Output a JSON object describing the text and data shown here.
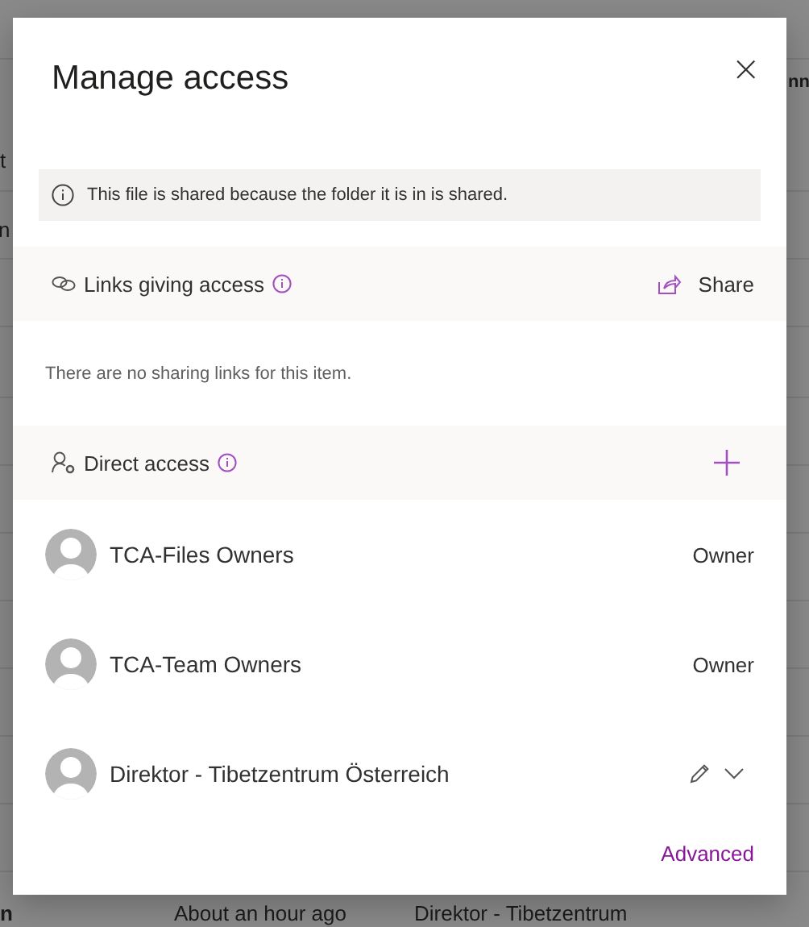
{
  "background": {
    "texts": [
      {
        "text": "nn"
      },
      {
        "text": "t"
      },
      {
        "text": "n"
      },
      {
        "text": "n"
      },
      {
        "text": "About an hour ago"
      },
      {
        "text": "Direktor - Tibetzentrum"
      }
    ]
  },
  "dialog": {
    "title": "Manage access",
    "close": "×",
    "notice": "This file is shared because the folder it is in is shared.",
    "links": {
      "heading": "Links giving access",
      "action": "Share",
      "empty": "There are no sharing links for this item."
    },
    "direct": {
      "heading": "Direct access"
    },
    "members": [
      {
        "name": "TCA-Files Owners",
        "kind": "role",
        "role": "Owner"
      },
      {
        "name": "TCA-Team Owners",
        "kind": "role",
        "role": "Owner"
      },
      {
        "name": "Direktor - Tibetzentrum Österreich",
        "kind": "editor"
      }
    ],
    "advanced": "Advanced"
  }
}
